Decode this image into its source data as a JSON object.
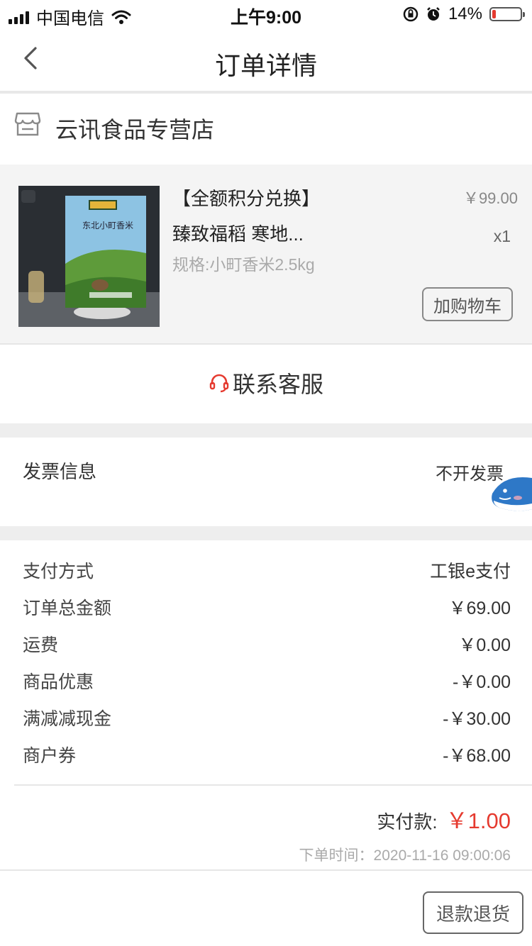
{
  "status_bar": {
    "carrier": "中国电信",
    "time": "上午9:00",
    "battery_text": "14%",
    "battery_level": 0.14
  },
  "header": {
    "title": "订单详情"
  },
  "store": {
    "name": "云讯食品专营店"
  },
  "product": {
    "title": "【全额积分兑换】",
    "name": "臻致福稻 寒地...",
    "spec": "规格:小町香米2.5kg",
    "price": "￥99.00",
    "quantity": "x1",
    "package_text": "东北小町香米",
    "add_to_cart_label": "加购物车"
  },
  "contact": {
    "label": "联系客服"
  },
  "invoice": {
    "label": "发票信息",
    "value": "不开发票"
  },
  "payment": {
    "rows": [
      {
        "label": "支付方式",
        "value": "工银e支付"
      },
      {
        "label": "订单总金额",
        "value": "￥69.00"
      },
      {
        "label": "运费",
        "value": "￥0.00"
      },
      {
        "label": "商品优惠",
        "value": "-￥0.00"
      },
      {
        "label": "满减减现金",
        "value": "-￥30.00"
      },
      {
        "label": "商户券",
        "value": "-￥68.00"
      }
    ],
    "total_label": "实付款:",
    "total_amount": "￥1.00",
    "order_time": "下单时间：2020-11-16 09:00:06"
  },
  "footer": {
    "refund_label": "退款退货"
  },
  "colors": {
    "accent": "#e53a2f",
    "background": "#ffffff",
    "divider": "#eeeeee"
  }
}
